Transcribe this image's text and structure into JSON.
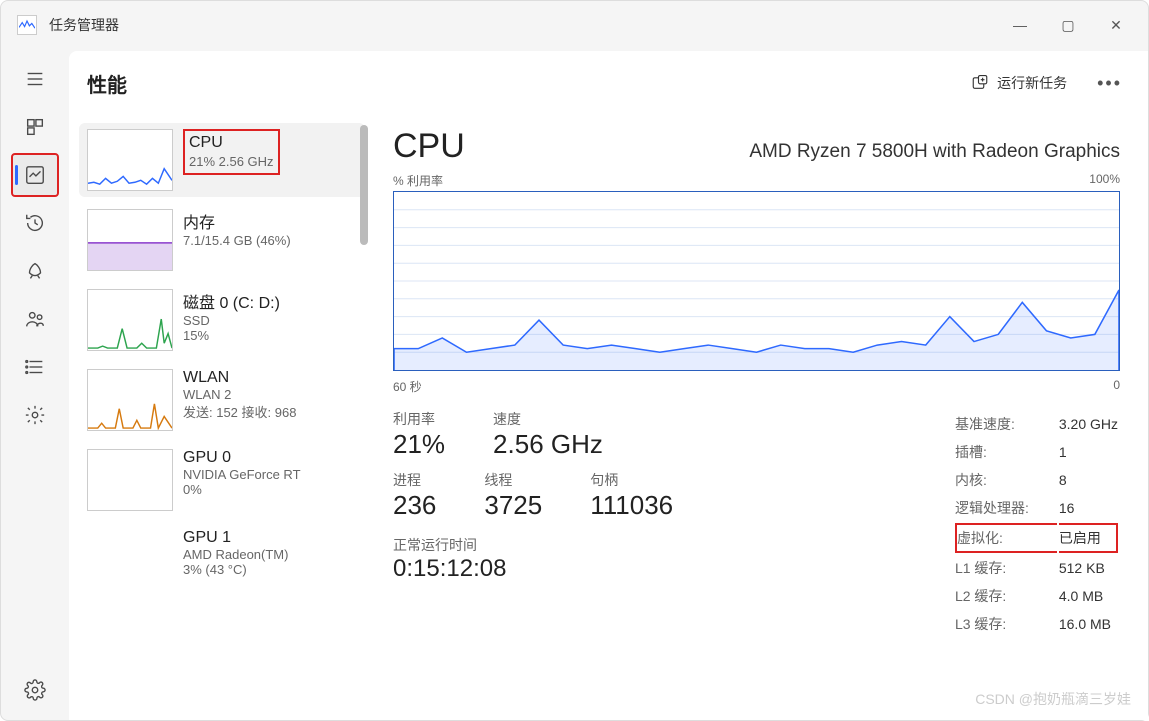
{
  "app": {
    "title": "任务管理器"
  },
  "page": {
    "title": "性能",
    "run_new_task": "运行新任务"
  },
  "sidebar": {
    "items": [
      {
        "title": "CPU",
        "sub": "21%  2.56 GHz"
      },
      {
        "title": "内存",
        "sub": "7.1/15.4 GB (46%)"
      },
      {
        "title": "磁盘 0 (C: D:)",
        "sub": "SSD",
        "sub2": "15%"
      },
      {
        "title": "WLAN",
        "sub": "WLAN 2",
        "sub2": "发送: 152 接收: 968"
      },
      {
        "title": "GPU 0",
        "sub": "NVIDIA GeForce RT",
        "sub2": "0%"
      },
      {
        "title": "GPU 1",
        "sub": "AMD Radeon(TM)",
        "sub2": "3%  (43 °C)"
      }
    ]
  },
  "main": {
    "title": "CPU",
    "model": "AMD Ryzen 7 5800H with Radeon Graphics",
    "chart_top_left": "% 利用率",
    "chart_top_right": "100%",
    "chart_bottom_left": "60 秒",
    "chart_bottom_right": "0",
    "stats_left": {
      "util_label": "利用率",
      "util_value": "21%",
      "speed_label": "速度",
      "speed_value": "2.56 GHz",
      "proc_label": "进程",
      "proc_value": "236",
      "threads_label": "线程",
      "threads_value": "3725",
      "handles_label": "句柄",
      "handles_value": "111036",
      "uptime_label": "正常运行时间",
      "uptime_value": "0:15:12:08"
    },
    "stats_right": {
      "base_speed_label": "基准速度:",
      "base_speed_value": "3.20 GHz",
      "sockets_label": "插槽:",
      "sockets_value": "1",
      "cores_label": "内核:",
      "cores_value": "8",
      "logical_label": "逻辑处理器:",
      "logical_value": "16",
      "virt_label": "虚拟化:",
      "virt_value": "已启用",
      "l1_label": "L1 缓存:",
      "l1_value": "512 KB",
      "l2_label": "L2 缓存:",
      "l2_value": "4.0 MB",
      "l3_label": "L3 缓存:",
      "l3_value": "16.0 MB"
    }
  },
  "chart_data": {
    "type": "line",
    "title": "% 利用率",
    "xlabel": "60 秒",
    "ylabel": "% 利用率",
    "ylim": [
      0,
      100
    ],
    "x": [
      0,
      2,
      4,
      6,
      8,
      10,
      12,
      14,
      16,
      18,
      20,
      22,
      24,
      26,
      28,
      30,
      32,
      34,
      36,
      38,
      40,
      42,
      44,
      46,
      48,
      50,
      52,
      54,
      56,
      58,
      60
    ],
    "values": [
      12,
      12,
      18,
      10,
      12,
      14,
      28,
      14,
      12,
      14,
      12,
      10,
      12,
      14,
      12,
      10,
      14,
      12,
      12,
      10,
      14,
      16,
      14,
      30,
      16,
      20,
      38,
      22,
      18,
      20,
      45
    ]
  },
  "watermark": "CSDN @抱奶瓶滴三岁娃"
}
